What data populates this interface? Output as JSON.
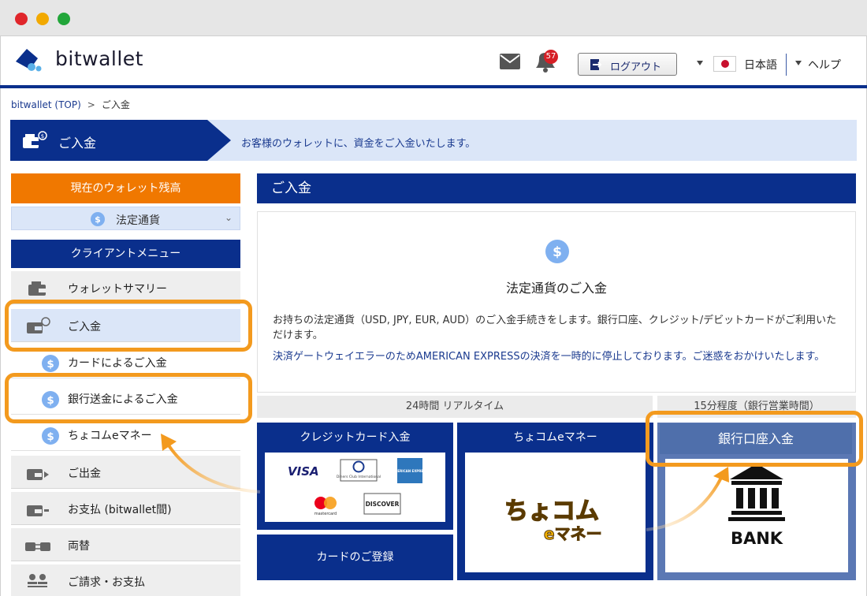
{
  "header": {
    "logo_text": "bitwallet",
    "notification_count": "57",
    "logout_label": "ログアウト",
    "language_label": "日本語",
    "help_label": "ヘルプ"
  },
  "breadcrumb": {
    "home": "bitwallet (TOP)",
    "separator": ">",
    "current": "ご入金"
  },
  "banner": {
    "title": "ご入金",
    "description": "お客様のウォレットに、資金をご入金いたします。"
  },
  "sidebar": {
    "balance_label": "現在のウォレット残高",
    "currency_label": "法定通貨",
    "menu_heading": "クライアントメニュー",
    "items": [
      {
        "label": "ウォレットサマリー"
      },
      {
        "label": "ご入金"
      },
      {
        "label": "カードによるご入金"
      },
      {
        "label": "銀行送金によるご入金"
      },
      {
        "label": "ちょコムeマネー"
      },
      {
        "label": "ご出金"
      },
      {
        "label": "お支払 (bitwallet間)"
      },
      {
        "label": "両替"
      },
      {
        "label": "ご請求・お支払"
      }
    ]
  },
  "main": {
    "heading": "ご入金",
    "title": "法定通貨のご入金",
    "description": "お持ちの法定通貨（USD, JPY, EUR, AUD）のご入金手続きをします。銀行口座、クレジット/デビットカードがご利用いただけます。",
    "notice": "決済ゲートウェイエラーのためAMERICAN EXPRESSの決済を一時的に停止しております。ご迷惑をおかけいたします。",
    "timing_realtime": "24時間 リアルタイム",
    "timing_bank": "15分程度（銀行営業時間）",
    "methods": {
      "credit_card": "クレジットカード入金",
      "chocom": "ちょコムeマネー",
      "bank": "銀行口座入金",
      "card_register": "カードのご登録"
    },
    "card_brands": {
      "visa": "VISA",
      "diners": "Diners Club International",
      "amex": "AMERICAN EXPRESS",
      "mastercard": "mastercard",
      "discover": "DISCOVER"
    },
    "chocom_logo": {
      "line1": "ちょコム",
      "line2": "eマネー"
    },
    "bank_logo_text": "BANK"
  },
  "colors": {
    "navy": "#0a2f8c",
    "orange": "#f07800",
    "highlight": "#f39a1e",
    "light_blue": "#dbe6f8",
    "bank_blue": "#4f6fab"
  }
}
